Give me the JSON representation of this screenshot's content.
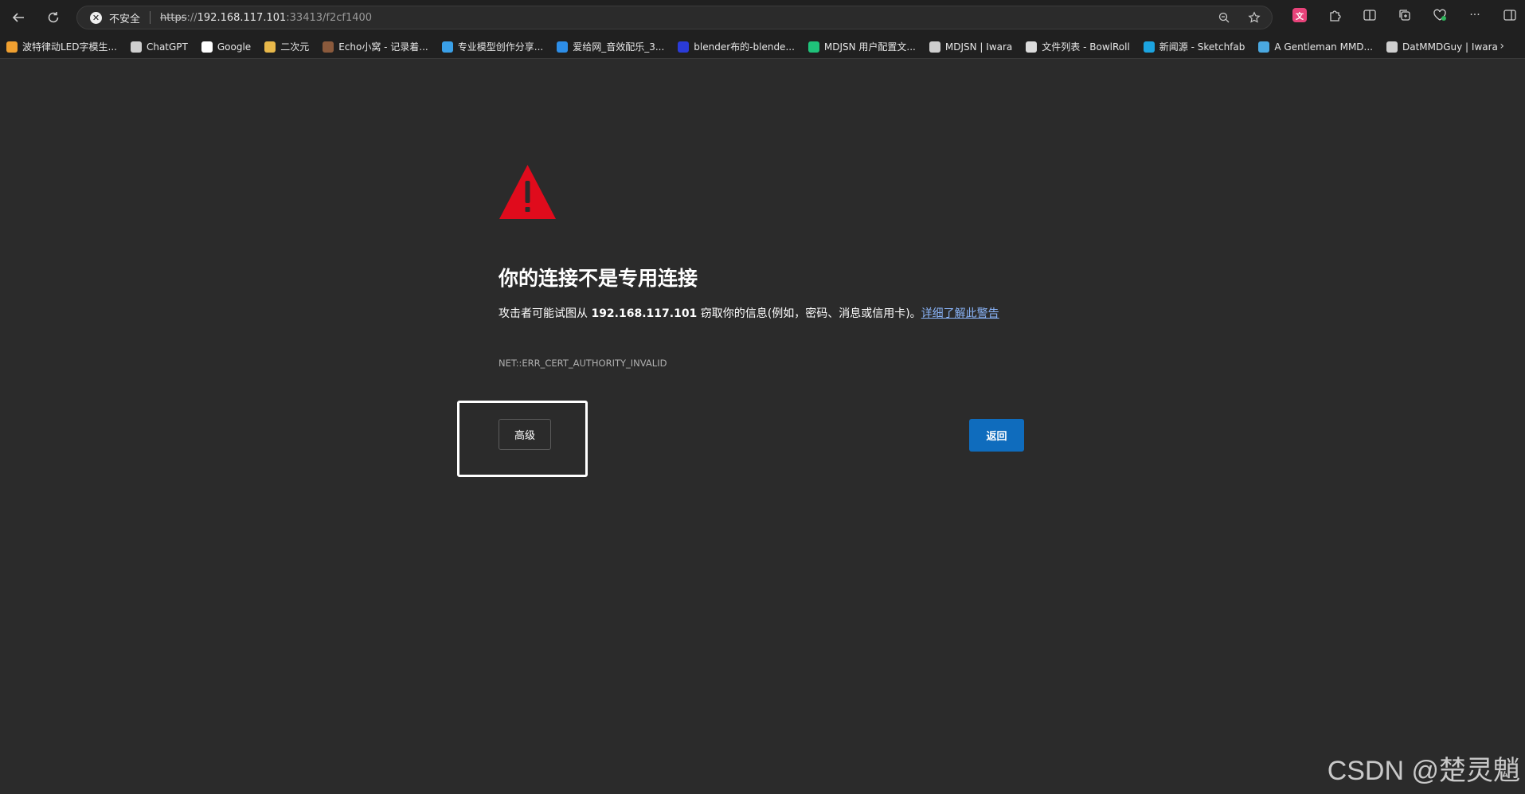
{
  "browser": {
    "security_label": "不安全",
    "url_scheme": "https",
    "url_sep": "://",
    "url_host": "192.168.117.101",
    "url_port_path": ":33413/f2cf1400"
  },
  "bookmarks": [
    {
      "label": "波特律动LED字模生...",
      "color": "#f0a030"
    },
    {
      "label": "ChatGPT",
      "color": "#cfcfcf"
    },
    {
      "label": "Google",
      "color": "#ffffff"
    },
    {
      "label": "二次元",
      "color": "#e8b84a"
    },
    {
      "label": "Echo小窝 - 记录着...",
      "color": "#8b5a3c"
    },
    {
      "label": "专业模型创作分享...",
      "color": "#3aa0e8"
    },
    {
      "label": "爱给网_音效配乐_3...",
      "color": "#2d8ee8"
    },
    {
      "label": "blender布的-blende...",
      "color": "#2a3bd8"
    },
    {
      "label": "MDJSN 用户配置文...",
      "color": "#1fc27a"
    },
    {
      "label": "MDJSN | Iwara",
      "color": "#cfcfcf"
    },
    {
      "label": "文件列表 - BowlRoll",
      "color": "#dcdcdc"
    },
    {
      "label": "新闻源 - Sketchfab",
      "color": "#1ca4e0"
    },
    {
      "label": "A Gentleman MMD...",
      "color": "#4aa8e0"
    },
    {
      "label": "DatMMDGuy | Iwara",
      "color": "#cfcfcf"
    }
  ],
  "error_page": {
    "heading": "你的连接不是专用连接",
    "desc_before": "攻击者可能试图从 ",
    "desc_host": "192.168.117.101",
    "desc_after": " 窃取你的信息(例如，密码、消息或信用卡)。",
    "learn_more": "详细了解此警告",
    "error_code": "NET::ERR_CERT_AUTHORITY_INVALID",
    "advanced_label": "高级",
    "back_label": "返回"
  },
  "watermark": "CSDN @楚灵魈",
  "colors": {
    "background": "#2b2b2b",
    "warning_red": "#e00b1c",
    "back_button": "#0f6cbd",
    "link": "#8ab4f8"
  }
}
